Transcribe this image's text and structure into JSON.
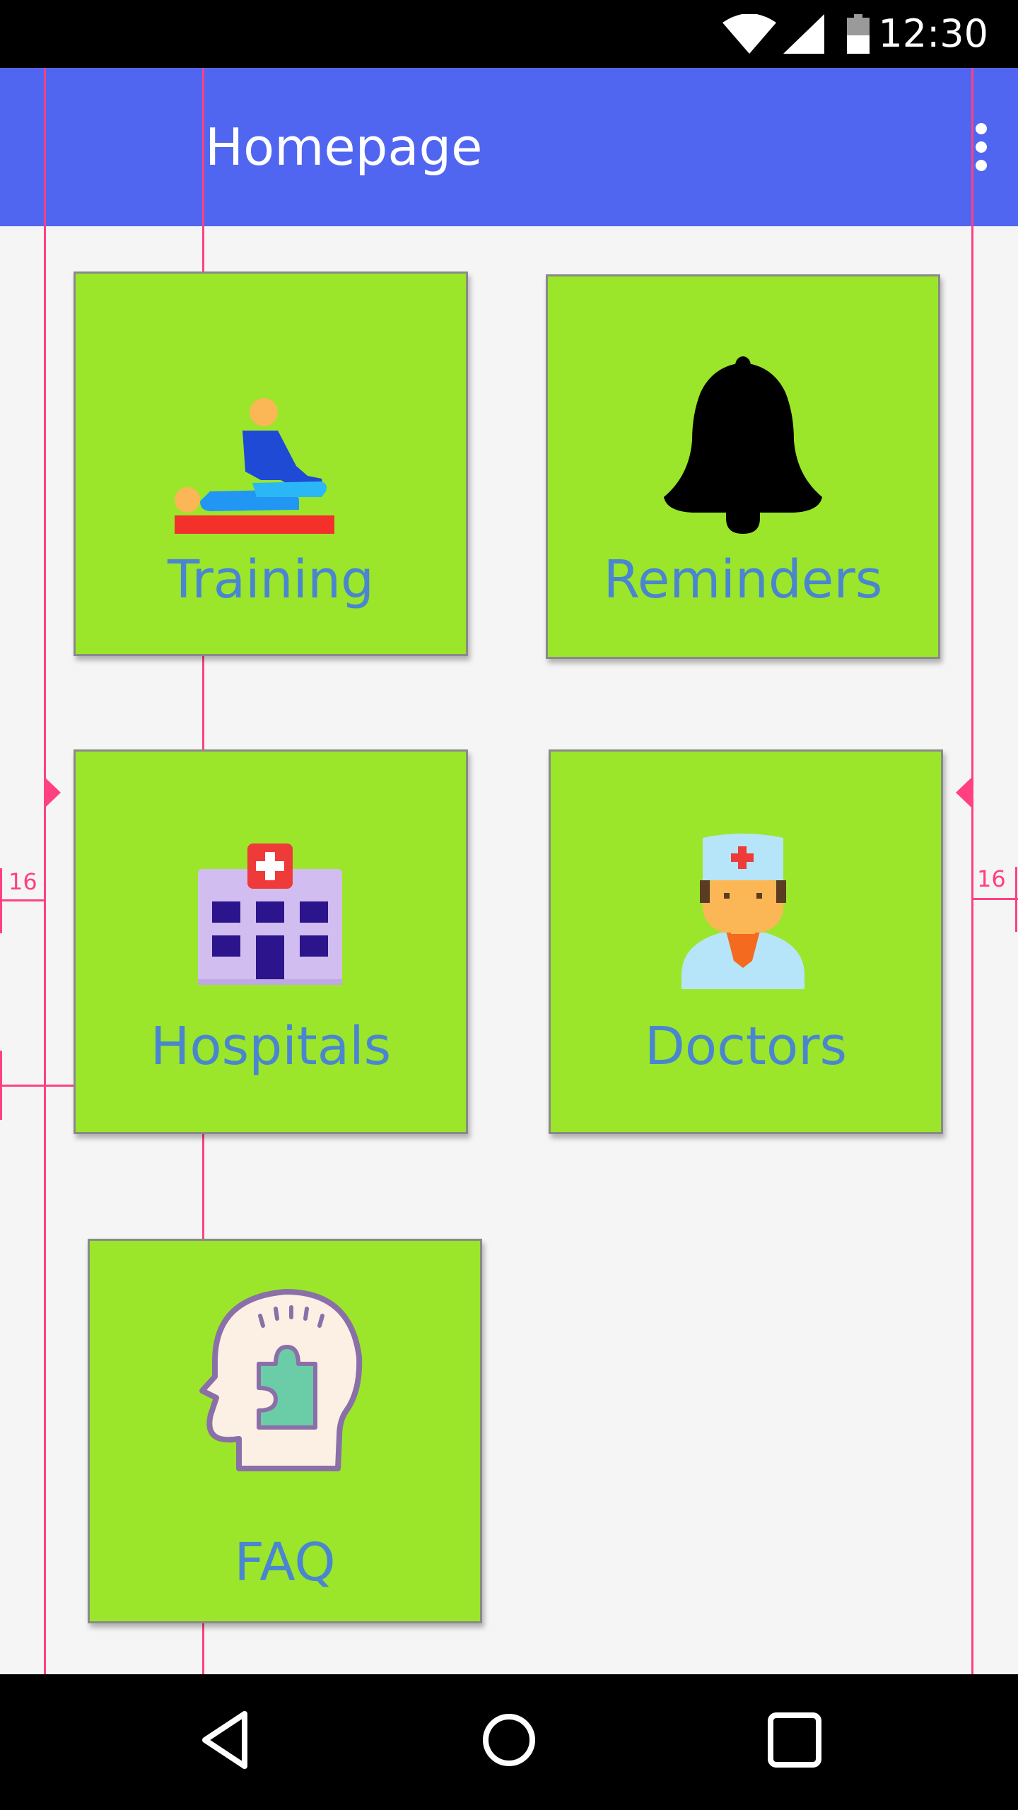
{
  "status_bar": {
    "time": "12:30",
    "icons": [
      "wifi-icon",
      "cell-signal-icon",
      "battery-icon"
    ]
  },
  "app_bar": {
    "title": "Homepage",
    "menu_icon": "more-vert-icon",
    "background": "#5166f0"
  },
  "tiles": [
    {
      "label": "Training",
      "icon": "physiotherapy-icon"
    },
    {
      "label": "Reminders",
      "icon": "bell-icon"
    },
    {
      "label": "Hospitals",
      "icon": "hospital-icon"
    },
    {
      "label": "Doctors",
      "icon": "doctor-icon"
    },
    {
      "label": "FAQ",
      "icon": "head-puzzle-icon"
    }
  ],
  "guides": {
    "margin_left_label": "16",
    "margin_right_label": "16"
  },
  "nav_bar": {
    "icons": [
      "back-icon",
      "home-icon",
      "recents-icon"
    ]
  },
  "colors": {
    "tile_background": "#9be52a",
    "tile_label": "#4a86d0",
    "guide": "#ff4081",
    "page_background": "#f5f5f5"
  }
}
